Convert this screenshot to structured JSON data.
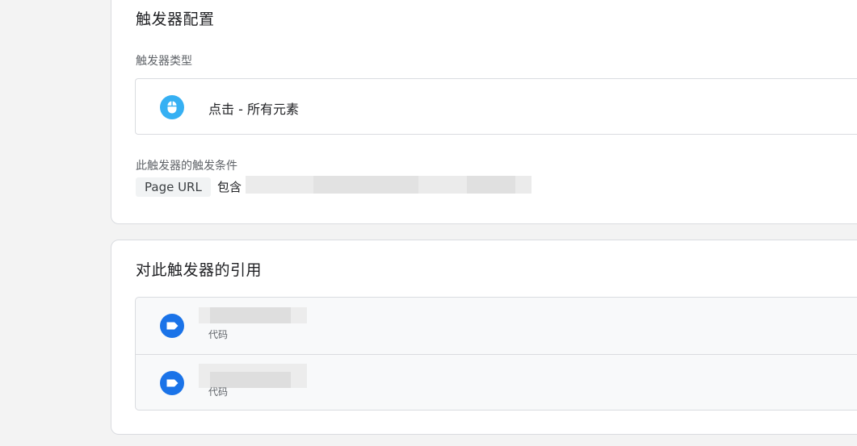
{
  "trigger_config": {
    "title": "触发器配置",
    "type_label": "触发器类型",
    "type_value": "点击 - 所有元素",
    "type_icon": "mouse-icon",
    "conditions_label": "此触发器的触发条件",
    "condition": {
      "variable": "Page URL",
      "operator": "包含"
    }
  },
  "references": {
    "title": "对此触发器的引用",
    "items": [
      {
        "icon": "tag-icon",
        "subtitle": "代码"
      },
      {
        "icon": "tag-icon",
        "subtitle": "代码"
      }
    ]
  },
  "colors": {
    "click_icon": "#36b0f3",
    "tag_icon": "#1a73e8",
    "page_bg": "#f3f3f3"
  }
}
